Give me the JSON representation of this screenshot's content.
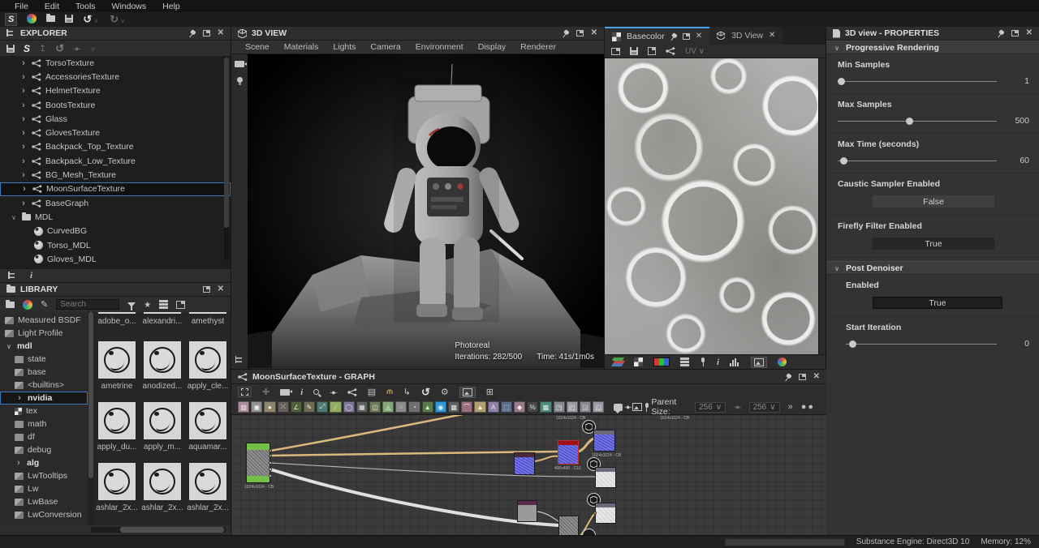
{
  "menu_bar": {
    "items": [
      "File",
      "Edit",
      "Tools",
      "Windows",
      "Help"
    ]
  },
  "explorer": {
    "title": "EXPLORER",
    "items": [
      "TorsoTexture",
      "AccessoriesTexture",
      "HelmetTexture",
      "BootsTexture",
      "Glass",
      "GlovesTexture",
      "Backpack_Top_Texture",
      "Backpack_Low_Texture",
      "BG_Mesh_Texture",
      "MoonSurfaceTexture",
      "BaseGraph"
    ],
    "selected_item": "MoonSurfaceTexture",
    "mdl_folder": {
      "label": "MDL",
      "children": [
        "CurvedBG",
        "Torso_MDL",
        "Gloves_MDL"
      ]
    }
  },
  "library": {
    "title": "LIBRARY",
    "search_placeholder": "Search",
    "tree": [
      {
        "label": "Measured BSDF"
      },
      {
        "label": "Light Profile"
      },
      {
        "label": "mdl"
      },
      {
        "label": "state"
      },
      {
        "label": "base"
      },
      {
        "label": "<builtins>"
      },
      {
        "label": "nvidia"
      },
      {
        "label": "tex"
      },
      {
        "label": "math"
      },
      {
        "label": "df"
      },
      {
        "label": "debug"
      },
      {
        "label": "alg"
      },
      {
        "label": "LwTooltips"
      },
      {
        "label": "Lw"
      },
      {
        "label": "LwBase"
      },
      {
        "label": "LwConversion"
      }
    ],
    "selected_tree_item": "nvidia",
    "grid_top_labels": [
      "adobe_o...",
      "alexandri...",
      "amethyst"
    ],
    "grid_rows": [
      {
        "labels": [
          "ametrine",
          "anodized...",
          "apply_cle..."
        ]
      },
      {
        "labels": [
          "apply_du...",
          "apply_m...",
          "aquamar..."
        ]
      },
      {
        "labels": [
          "ashlar_2x...",
          "ashlar_2x...",
          "ashlar_2x..."
        ]
      }
    ]
  },
  "view3d": {
    "title": "3D VIEW",
    "menus": [
      "Scene",
      "Materials",
      "Lights",
      "Camera",
      "Environment",
      "Display",
      "Renderer"
    ],
    "overlay": {
      "renderer": "Photoreal",
      "iterations": "Iterations: 282/500",
      "time": "Time: 41s/1m0s"
    }
  },
  "view2d": {
    "tabs": [
      {
        "label": "Basecolor"
      },
      {
        "label": "3D View"
      }
    ],
    "uv_label": "UV"
  },
  "graph": {
    "title": "MoonSurfaceTexture - GRAPH",
    "parent_size_label": "Parent Size:",
    "parent_width": "256",
    "parent_height": "256",
    "node_labels": [
      "1024x1024 - CB",
      "1024x1024 - CB",
      "1024x1024 - CB",
      "400x400 - C16",
      "1024x1024 - CB"
    ]
  },
  "properties": {
    "title": "3D view - PROPERTIES",
    "sections": [
      {
        "label": "Progressive Rendering"
      },
      {
        "label": "Post Denoiser"
      }
    ],
    "min_samples": {
      "label": "Min Samples",
      "value": "1"
    },
    "max_samples": {
      "label": "Max Samples",
      "value": "500"
    },
    "max_time": {
      "label": "Max Time (seconds)",
      "value": "60"
    },
    "caustic": {
      "label": "Caustic Sampler Enabled",
      "value": "False"
    },
    "firefly": {
      "label": "Firefly Filter Enabled",
      "value": "True"
    },
    "pd_enabled": {
      "label": "Enabled",
      "value": "True"
    },
    "start_iteration": {
      "label": "Start Iteration",
      "value": "0"
    }
  },
  "status_bar": {
    "engine": "Substance Engine: Direct3D 10",
    "memory": "Memory: 12%"
  },
  "colors": {
    "accent_blue": "#3a7bbf",
    "tab_active_line": "#4aa3e8",
    "wire_tan": "#d9b97c",
    "wire_white": "#e0e0e0",
    "node_green": "#72c04a",
    "node_blue": "#5558d8",
    "node_red_header": "#a01010"
  }
}
